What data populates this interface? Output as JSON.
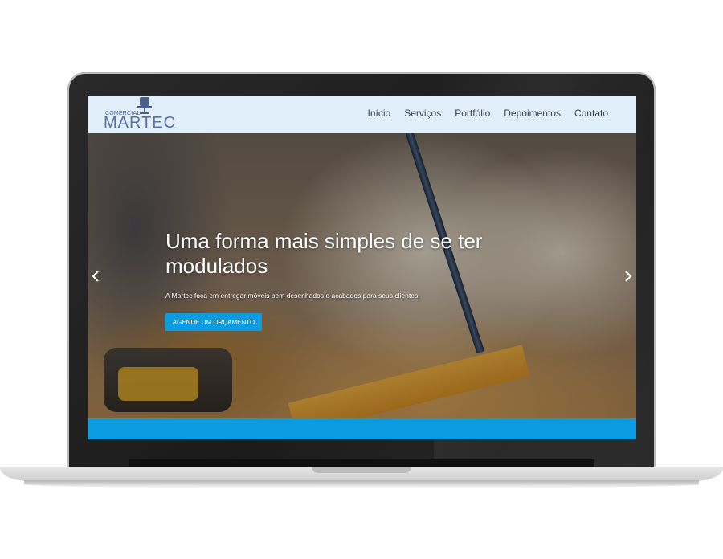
{
  "brand": {
    "logo_top": "COMERCIAL",
    "logo_main": "MARTEC"
  },
  "nav": {
    "items": [
      {
        "label": "Início"
      },
      {
        "label": "Serviços"
      },
      {
        "label": "Portfólio"
      },
      {
        "label": "Depoimentos"
      },
      {
        "label": "Contato"
      }
    ]
  },
  "hero": {
    "title": "Uma forma mais simples de se ter modulados",
    "subtitle": "A Martec foca em entregar móveis bem desenhados e acabados para seus clientes.",
    "cta_label": "AGENDE UM ORÇAMENTO"
  },
  "colors": {
    "accent": "#0b9be0",
    "navbar_bg": "#e1effa",
    "nav_text": "#3a3f4c",
    "logo": "#5a6fa6"
  },
  "icons": {
    "prev": "chevron-left-icon",
    "next": "chevron-right-icon",
    "logo": "chair-icon"
  }
}
